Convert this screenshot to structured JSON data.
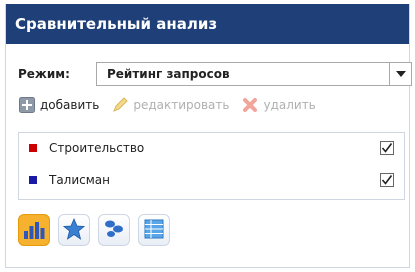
{
  "panel": {
    "title": "Сравнительный анализ"
  },
  "mode": {
    "label": "Режим:",
    "selected": "Рейтинг запросов"
  },
  "toolbar": {
    "add_label": "добавить",
    "edit_label": "редактировать",
    "delete_label": "удалить"
  },
  "items": [
    {
      "label": "Строительство",
      "color": "#cc0000",
      "checked": true
    },
    {
      "label": "Талисман",
      "color": "#1a1aa6",
      "checked": true
    }
  ],
  "views": [
    {
      "icon": "bar-chart-icon",
      "active": true
    },
    {
      "icon": "star-chart-icon",
      "active": false
    },
    {
      "icon": "bubble-chart-icon",
      "active": false
    },
    {
      "icon": "table-icon",
      "active": false
    }
  ],
  "colors": {
    "title_bg": "#1f3f78",
    "active_view": "#f6b12f"
  }
}
